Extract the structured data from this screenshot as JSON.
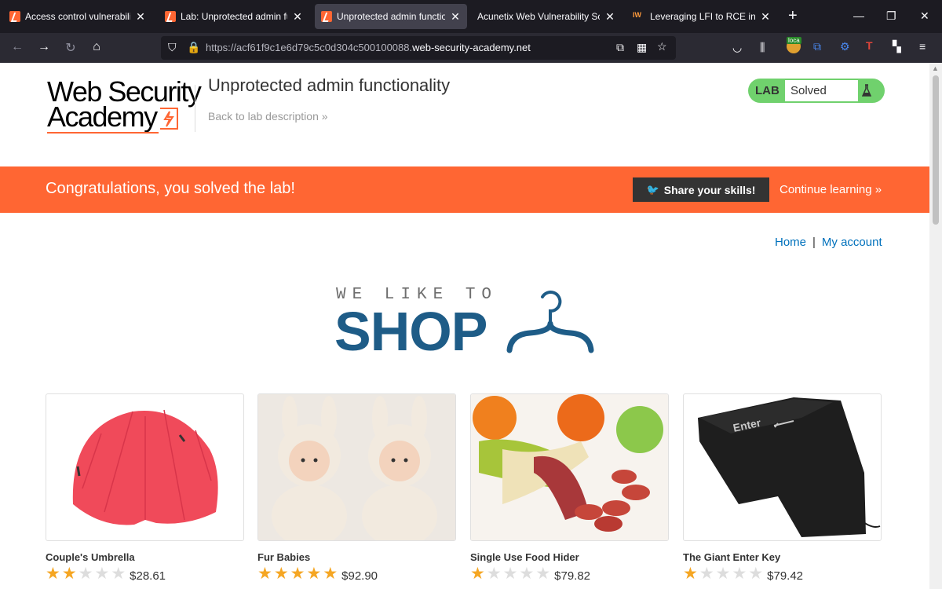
{
  "browser": {
    "tabs": [
      {
        "title": "Access control vulnerabilities",
        "favicon": "portswigger-icon"
      },
      {
        "title": "Lab: Unprotected admin functionality",
        "favicon": "portswigger-icon"
      },
      {
        "title": "Unprotected admin functionality",
        "favicon": "portswigger-icon",
        "active": true
      },
      {
        "title": "Acunetix Web Vulnerability Scanner",
        "favicon": "none"
      },
      {
        "title": "Leveraging LFI to RCE in a website",
        "favicon": "iw"
      }
    ],
    "tab_favicon_iw": "IW",
    "url_prefix": "https://acf61f9c1e6d79c5c0d304c500100088.",
    "url_domain": "web-security-academy.net",
    "ext_badge": "loca"
  },
  "header": {
    "logo_line1": "Web Security",
    "logo_line2": "Academy",
    "lab_title": "Unprotected admin functionality",
    "back_link": "Back to lab description",
    "lab_badge_label": "LAB",
    "lab_status": "Solved"
  },
  "banner": {
    "message": "Congratulations, you solved the lab!",
    "share_label": "Share your skills!",
    "continue_label": "Continue learning"
  },
  "nav": {
    "home": "Home",
    "separator": "|",
    "account": "My account"
  },
  "hero": {
    "tagline": "WE LIKE TO",
    "word": "SHOP"
  },
  "products": [
    {
      "name": "Couple's Umbrella",
      "rating": 2,
      "price": "$28.61"
    },
    {
      "name": "Fur Babies",
      "rating": 5,
      "price": "$92.90"
    },
    {
      "name": "Single Use Food Hider",
      "rating": 1,
      "price": "$79.82"
    },
    {
      "name": "The Giant Enter Key",
      "rating": 1,
      "price": "$79.42"
    }
  ],
  "product_image_text": {
    "enter_key": "Enter"
  },
  "colors": {
    "accent": "#ff6633",
    "lab_green": "#70d16d",
    "link_blue": "#0071bc",
    "shop_blue": "#1e5c87",
    "star": "#f5a623"
  }
}
